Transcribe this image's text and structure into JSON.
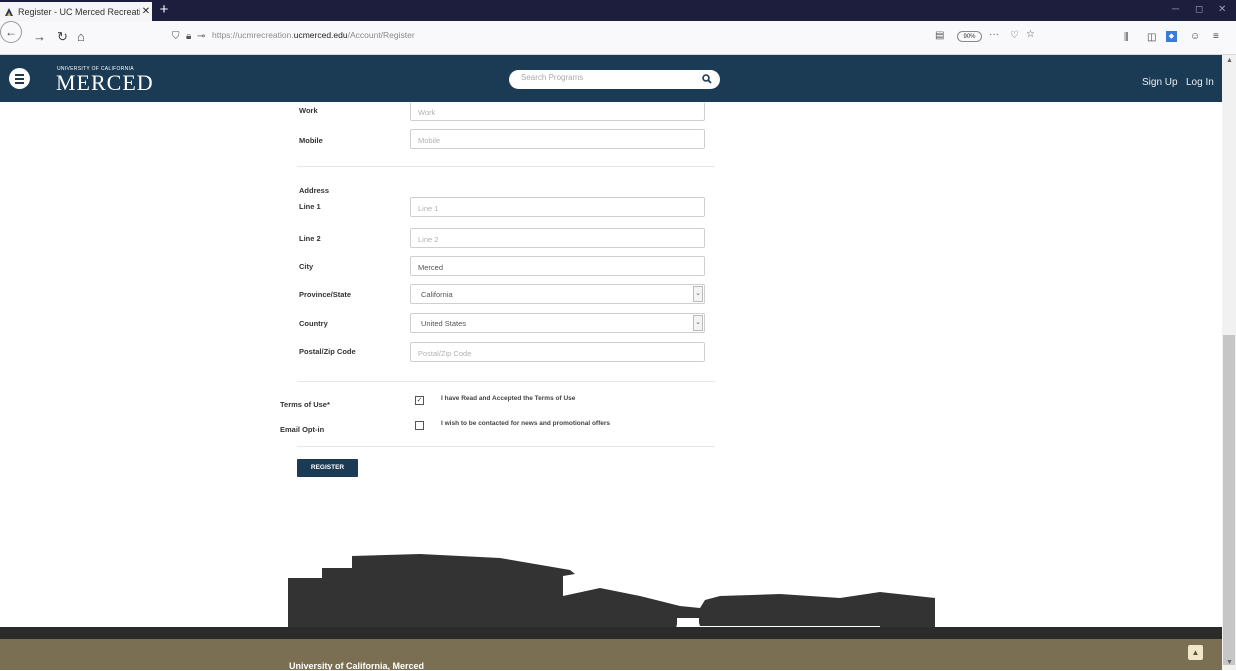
{
  "browser": {
    "tab_title": "Register - UC Merced Recreati...",
    "tab_close": "✕",
    "new_tab": "+",
    "url_prefix": "https://ucmrecreation.",
    "url_domain": "ucmerced.edu",
    "url_path": "/Account/Register",
    "zoom": "90%",
    "more": "···"
  },
  "site": {
    "logo_top": "UNIVERSITY OF CALIFORNIA",
    "logo_main": "MERCED",
    "search_placeholder": "Search Programs",
    "signup": "Sign Up",
    "login": "Log In"
  },
  "form": {
    "work": {
      "label": "Work",
      "placeholder": "Work"
    },
    "mobile": {
      "label": "Mobile",
      "placeholder": "Mobile"
    },
    "address_heading": "Address",
    "line1": {
      "label": "Line 1",
      "placeholder": "Line 1"
    },
    "line2": {
      "label": "Line 2",
      "placeholder": "Line 2"
    },
    "city": {
      "label": "City",
      "value": "Merced"
    },
    "province": {
      "label": "Province/State",
      "value": "California"
    },
    "country": {
      "label": "Country",
      "value": "United States"
    },
    "postal": {
      "label": "Postal/Zip Code",
      "placeholder": "Postal/Zip Code"
    },
    "terms": {
      "label": "Terms of Use*",
      "text": "I have Read and Accepted the Terms of Use",
      "checked": true
    },
    "optin": {
      "label": "Email Opt-in",
      "text": "I wish to be contacted for news and promotional offers",
      "checked": false
    },
    "register": "REGISTER"
  },
  "footer": {
    "title": "University of California, Merced"
  },
  "colors": {
    "header": "#1b3b55",
    "footer_olive": "#7a6f52",
    "skyline": "#333333"
  }
}
